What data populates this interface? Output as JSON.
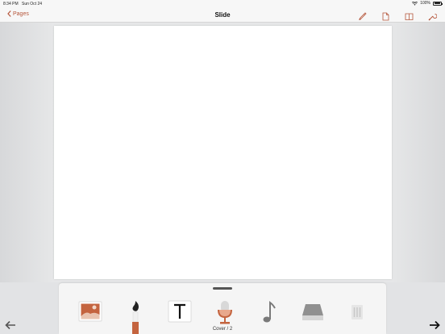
{
  "status_bar": {
    "time": "8:34 PM",
    "date": "Sun Oct 24",
    "battery": "100%"
  },
  "nav_bar": {
    "back_label": "Pages",
    "title": "Slide",
    "icons": [
      "brush-icon",
      "page-icon",
      "book-icon",
      "wrench-icon"
    ]
  },
  "tray": {
    "tools": [
      "image-icon",
      "paintbrush-icon",
      "text-icon",
      "microphone-icon",
      "music-note-icon",
      "eraser-icon",
      "trash-icon"
    ],
    "page_label": "Cover / 2"
  },
  "colors": {
    "accent": "#b5553a",
    "background": "#e2e3e5",
    "page": "#ffffff"
  }
}
